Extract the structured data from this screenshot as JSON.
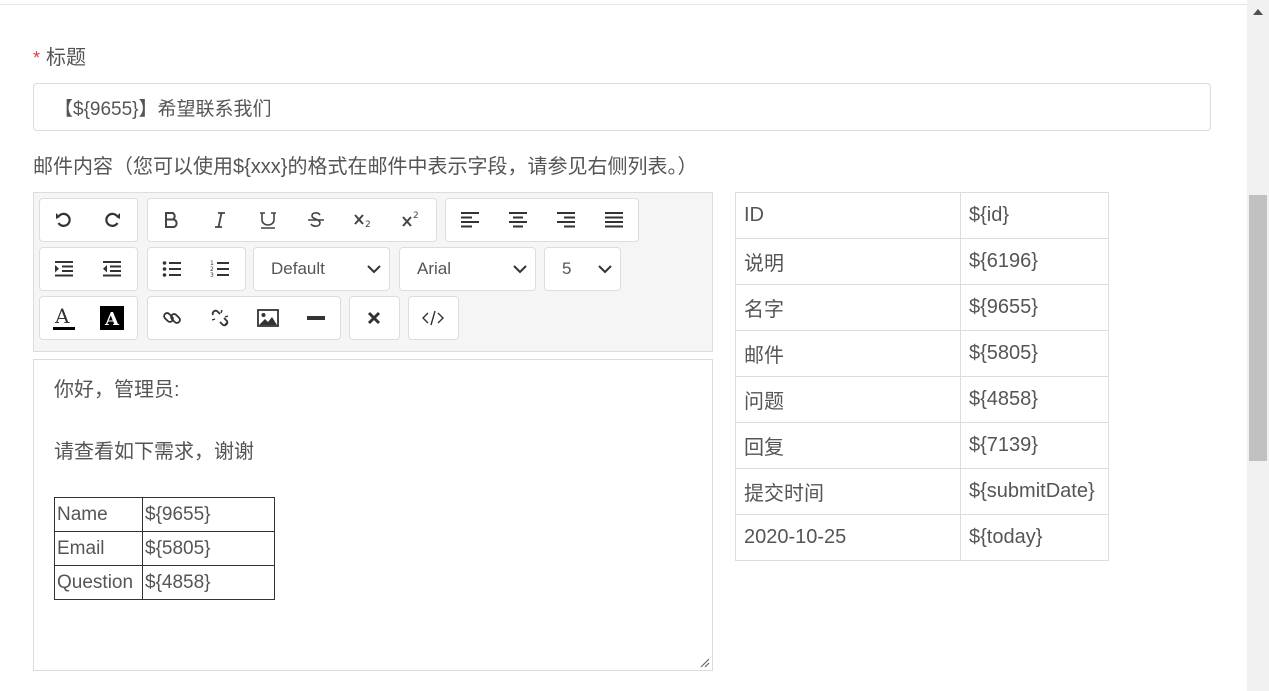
{
  "form": {
    "title_required_mark": "*",
    "title_label": "标题",
    "title_value": "【${9655}】希望联系我们",
    "content_label": "邮件内容（您可以使用${xxx}的格式在邮件中表示字段，请参见右侧列表。）"
  },
  "toolbar": {
    "font_size_select": "Default",
    "font_family_select": "Arial",
    "font_number_select": "5"
  },
  "editor": {
    "greeting": "你好，管理员:",
    "message": "请查看如下需求，谢谢",
    "rows": [
      {
        "label": "Name",
        "value": "${9655}"
      },
      {
        "label": "Email",
        "value": "${5805}"
      },
      {
        "label": "Question",
        "value": "${4858}"
      }
    ]
  },
  "fields": [
    {
      "name": "ID",
      "var": "${id}"
    },
    {
      "name": "说明",
      "var": "${6196}"
    },
    {
      "name": "名字",
      "var": "${9655}"
    },
    {
      "name": "邮件",
      "var": "${5805}"
    },
    {
      "name": "问题",
      "var": "${4858}"
    },
    {
      "name": "回复",
      "var": "${7139}"
    },
    {
      "name": "提交时间",
      "var": "${submitDate}"
    },
    {
      "name": "2020-10-25",
      "var": "${today}"
    }
  ],
  "colors": {
    "required": "#e4393c",
    "toolbar_bg": "#f5f5f5",
    "scroll_thumb": "#c1c1c1"
  }
}
